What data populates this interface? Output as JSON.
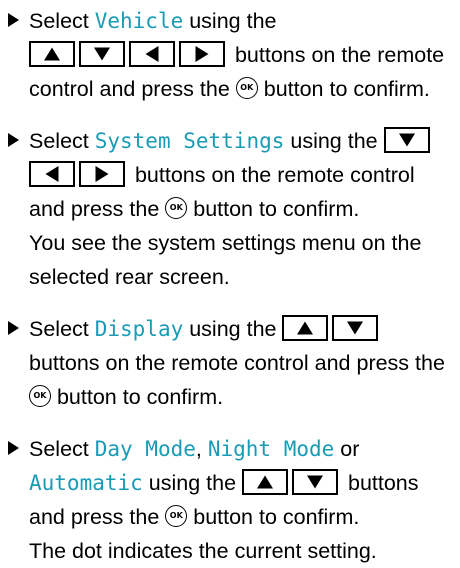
{
  "steps": [
    {
      "before": "Select ",
      "ui_term": "Vehicle",
      "using": " using the",
      "after_buttons": " buttons on the remote control and press the ",
      "ok_label": "OK",
      "end": " button to confirm."
    },
    {
      "before": "Select ",
      "ui_term": "System Settings",
      "using": " using the ",
      "after_buttons": " buttons on the remote control and press the ",
      "ok_label": "OK",
      "end": " button to confirm.",
      "note": "You see the system settings menu on the selected rear screen."
    },
    {
      "before": "Select ",
      "ui_term": "Display",
      "using": " using the ",
      "after_buttons": " buttons on the remote control and press the ",
      "ok_label": "OK",
      "end": " button to confirm."
    },
    {
      "before": "Select ",
      "ui_term_1": "Day Mode",
      "sep_1": ", ",
      "ui_term_2": "Night Mode",
      "sep_2": " or ",
      "ui_term_3": "Automatic",
      "using": " using the ",
      "after_buttons": " buttons and press the ",
      "ok_label": "OK",
      "end": " button to confirm.",
      "note": "The dot indicates the current setting."
    }
  ],
  "icons": {
    "bullet": "triangle-right-bullet-icon",
    "up": "arrow-up-key-icon",
    "down": "arrow-down-key-icon",
    "left": "arrow-left-key-icon",
    "right": "arrow-right-key-icon",
    "ok": "ok-button-icon"
  },
  "colors": {
    "ui_term": "#1a9bb5",
    "text": "#000000"
  }
}
